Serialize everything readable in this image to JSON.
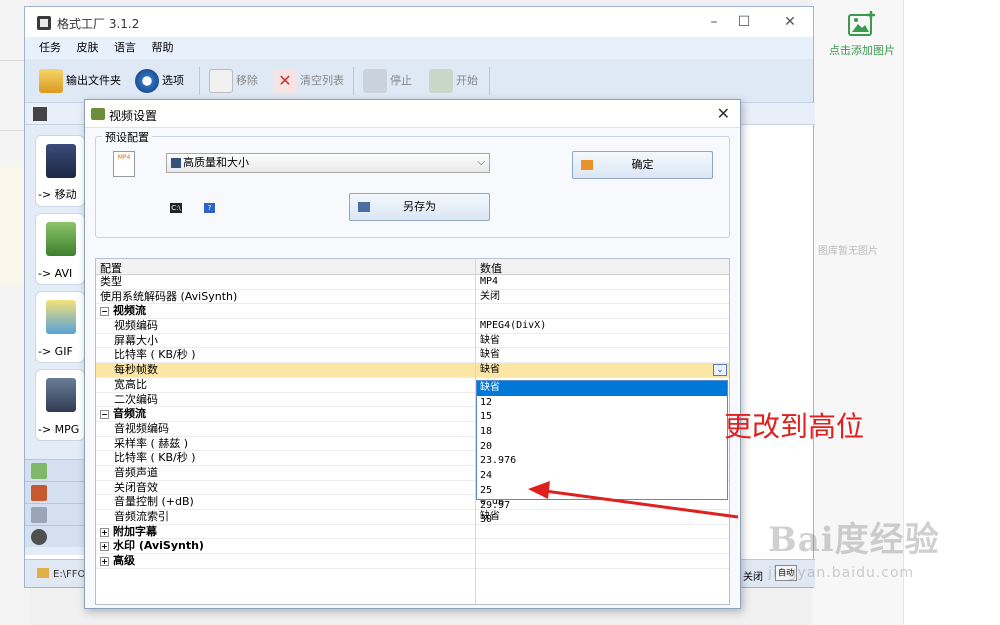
{
  "main_window": {
    "title": "格式工厂 3.1.2",
    "menu": [
      "任务",
      "皮肤",
      "语言",
      "帮助"
    ],
    "toolbar": {
      "output_folder": "输出文件夹",
      "options": "选项",
      "remove": "移除",
      "clear_list": "清空列表",
      "stop": "停止",
      "start": "开始"
    },
    "categories": [
      "-> 移动",
      "-> AVI",
      "-> GIF",
      "-> MPG"
    ],
    "status_path": "E:\\FFO",
    "status_right": "关闭",
    "status_badge": "自动"
  },
  "background": {
    "add_image": "点击添加图片",
    "empty_gallery": "图库暂无图片",
    "watermark_big": "Bai度经验",
    "watermark_small": "jingyan.baidu.com"
  },
  "dialog": {
    "title": "视频设置",
    "preset_legend": "预设配置",
    "preset_value": "高质量和大小",
    "ok_label": "确定",
    "save_as_label": "另存为",
    "mp4_label": "MP4",
    "grid": {
      "header_config": "配置",
      "header_value": "数值",
      "rows": [
        {
          "k": "类型",
          "v": "MP4",
          "indent": 0,
          "group": false
        },
        {
          "k": "使用系统解码器 (AviSynth)",
          "v": "关闭",
          "indent": 0,
          "group": false
        },
        {
          "k": "视频流",
          "v": "",
          "indent": 0,
          "group": true,
          "exp": "−"
        },
        {
          "k": "视频编码",
          "v": "MPEG4(DivX)",
          "indent": 1,
          "group": false
        },
        {
          "k": "屏幕大小",
          "v": "缺省",
          "indent": 1,
          "group": false
        },
        {
          "k": "比特率 ( KB/秒 )",
          "v": "缺省",
          "indent": 1,
          "group": false
        },
        {
          "k": "每秒帧数",
          "v": "缺省",
          "indent": 1,
          "group": false,
          "selected": true
        },
        {
          "k": "宽高比",
          "v": "",
          "indent": 1,
          "group": false
        },
        {
          "k": "二次编码",
          "v": "",
          "indent": 1,
          "group": false
        },
        {
          "k": "音频流",
          "v": "",
          "indent": 0,
          "group": true,
          "exp": "−"
        },
        {
          "k": "音视频编码",
          "v": "",
          "indent": 1,
          "group": false
        },
        {
          "k": "采样率 ( 赫兹 )",
          "v": "",
          "indent": 1,
          "group": false
        },
        {
          "k": "比特率 ( KB/秒 )",
          "v": "",
          "indent": 1,
          "group": false
        },
        {
          "k": "音频声道",
          "v": "",
          "indent": 1,
          "group": false
        },
        {
          "k": "关闭音效",
          "v": "",
          "indent": 1,
          "group": false
        },
        {
          "k": "音量控制 (+dB)",
          "v": "0 dB",
          "indent": 1,
          "group": false
        },
        {
          "k": "音频流索引",
          "v": "缺省",
          "indent": 1,
          "group": false
        },
        {
          "k": "附加字幕",
          "v": "",
          "indent": 0,
          "group": true,
          "exp": "+"
        },
        {
          "k": "水印 (AviSynth)",
          "v": "",
          "indent": 0,
          "group": true,
          "exp": "+"
        },
        {
          "k": "高级",
          "v": "",
          "indent": 0,
          "group": true,
          "exp": "+"
        }
      ]
    },
    "fps_options": [
      "缺省",
      "12",
      "15",
      "18",
      "20",
      "23.976",
      "24",
      "25",
      "29.97",
      "30"
    ],
    "fps_highlighted": "缺省"
  },
  "annotation": "更改到高位",
  "colors": {
    "accent_blue": "#0078d7",
    "selected_row": "#fbe6a6",
    "annotation_red": "#e0201e"
  }
}
